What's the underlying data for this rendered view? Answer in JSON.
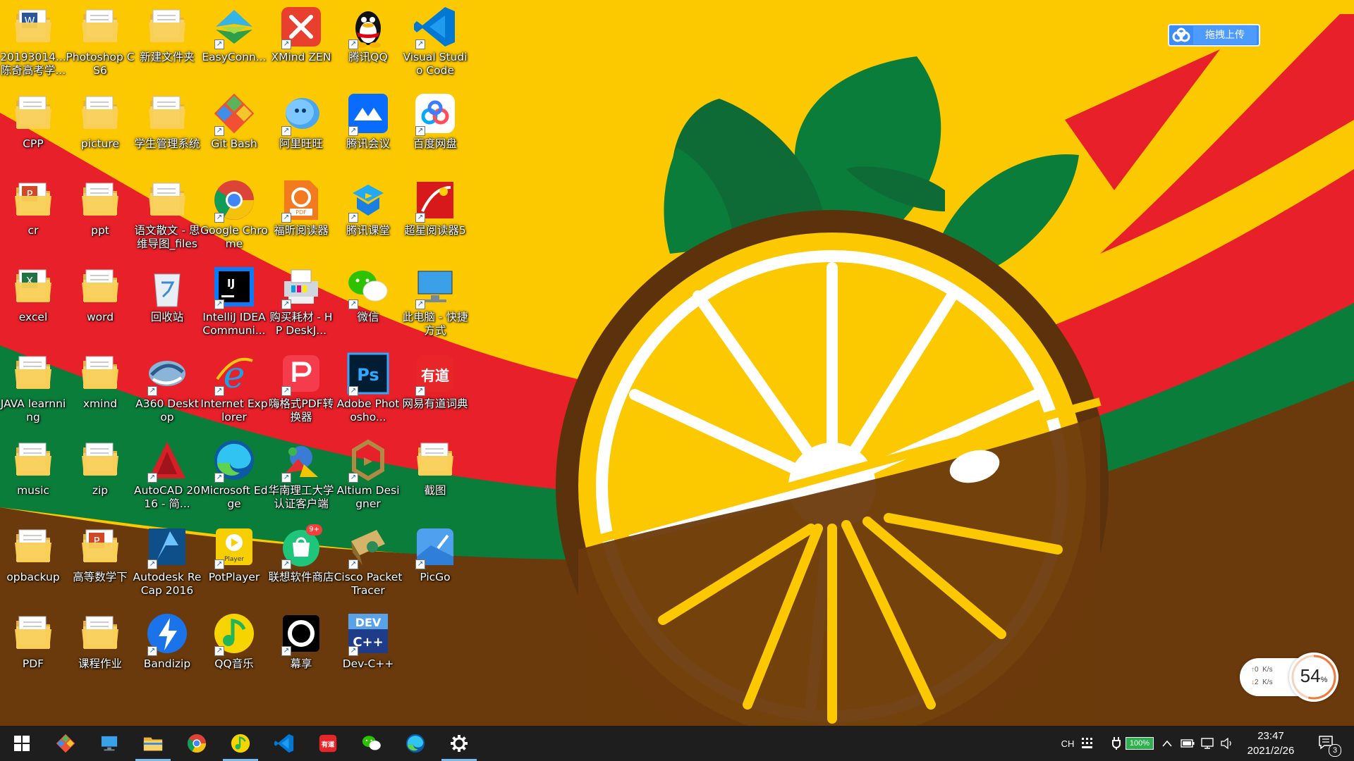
{
  "desktop": {
    "icons": [
      {
        "label": "20193014... 陈奇高考学...",
        "icon": "word-folder-icon",
        "shortcut": false
      },
      {
        "label": "Photoshop CS6",
        "icon": "folder-icon",
        "shortcut": false
      },
      {
        "label": "新建文件夹",
        "icon": "folder-icon",
        "shortcut": false
      },
      {
        "label": "EasyConn...",
        "icon": "easyconnect-icon",
        "shortcut": true
      },
      {
        "label": "XMind ZEN",
        "icon": "xmind-icon",
        "shortcut": true
      },
      {
        "label": "腾讯QQ",
        "icon": "qq-penguin-icon",
        "shortcut": true
      },
      {
        "label": "Visual Studio Code",
        "icon": "vscode-icon",
        "shortcut": true
      },
      {
        "label": "CPP",
        "icon": "folder-icon",
        "shortcut": false
      },
      {
        "label": "picture",
        "icon": "folder-icon",
        "shortcut": false
      },
      {
        "label": "学生管理系统",
        "icon": "folder-icon",
        "shortcut": false
      },
      {
        "label": "Git Bash",
        "icon": "git-bash-icon",
        "shortcut": true
      },
      {
        "label": "阿里旺旺",
        "icon": "aliwangwang-icon",
        "shortcut": true
      },
      {
        "label": "腾讯会议",
        "icon": "tencent-meeting-icon",
        "shortcut": true
      },
      {
        "label": "百度网盘",
        "icon": "baidu-netdisk-icon",
        "shortcut": true
      },
      {
        "label": "cr",
        "icon": "ppt-folder-icon",
        "shortcut": false
      },
      {
        "label": "ppt",
        "icon": "folder-icon",
        "shortcut": false
      },
      {
        "label": "语文散文 - 思维导图_files",
        "icon": "folder-icon",
        "shortcut": false
      },
      {
        "label": "Google Chrome",
        "icon": "chrome-icon",
        "shortcut": true
      },
      {
        "label": "福昕阅读器",
        "icon": "foxit-reader-icon",
        "shortcut": true
      },
      {
        "label": "腾讯课堂",
        "icon": "tencent-classroom-icon",
        "shortcut": true
      },
      {
        "label": "超星阅读器5",
        "icon": "chaoxing-reader-icon",
        "shortcut": true
      },
      {
        "label": "excel",
        "icon": "excel-folder-icon",
        "shortcut": false
      },
      {
        "label": "word",
        "icon": "folder-icon",
        "shortcut": false
      },
      {
        "label": "回收站",
        "icon": "recycle-bin-icon",
        "shortcut": false
      },
      {
        "label": "IntelliJ IDEA Communi...",
        "icon": "intellij-idea-icon",
        "shortcut": true
      },
      {
        "label": "购买耗材 - HP DeskJ...",
        "icon": "hp-printer-icon",
        "shortcut": true
      },
      {
        "label": "微信",
        "icon": "wechat-icon",
        "shortcut": true
      },
      {
        "label": "此电脑 - 快捷方式",
        "icon": "this-pc-icon",
        "shortcut": true
      },
      {
        "label": "JAVA learnning",
        "icon": "folder-icon",
        "shortcut": false
      },
      {
        "label": "xmind",
        "icon": "folder-icon",
        "shortcut": false
      },
      {
        "label": "A360 Desktop",
        "icon": "a360-icon",
        "shortcut": true
      },
      {
        "label": "Internet Explorer",
        "icon": "internet-explorer-icon",
        "shortcut": true
      },
      {
        "label": "嗨格式PDF转换器",
        "icon": "pdf-converter-icon",
        "shortcut": true
      },
      {
        "label": "Adobe Photosho...",
        "icon": "photoshop-icon",
        "shortcut": true
      },
      {
        "label": "网易有道词典",
        "icon": "youdao-dict-icon",
        "shortcut": true
      },
      {
        "label": "music",
        "icon": "folder-icon",
        "shortcut": false
      },
      {
        "label": "zip",
        "icon": "folder-icon",
        "shortcut": false
      },
      {
        "label": "AutoCAD 2016 - 简...",
        "icon": "autocad-icon",
        "shortcut": true
      },
      {
        "label": "Microsoft Edge",
        "icon": "edge-icon",
        "shortcut": true
      },
      {
        "label": "华南理工大学认证客户端",
        "icon": "scut-client-icon",
        "shortcut": true
      },
      {
        "label": "Altium Designer",
        "icon": "altium-designer-icon",
        "shortcut": true
      },
      {
        "label": "截图",
        "icon": "folder-icon",
        "shortcut": false
      },
      {
        "label": "opbackup",
        "icon": "folder-icon",
        "shortcut": false
      },
      {
        "label": "高等数学下",
        "icon": "ppt-folder-icon",
        "shortcut": false
      },
      {
        "label": "Autodesk ReCap 2016",
        "icon": "autodesk-recap-icon",
        "shortcut": true
      },
      {
        "label": "PotPlayer",
        "icon": "potplayer-icon",
        "shortcut": true
      },
      {
        "label": "联想软件商店",
        "icon": "lenovo-store-icon",
        "shortcut": true,
        "badge": "9+"
      },
      {
        "label": "Cisco Packet Tracer",
        "icon": "cisco-packet-tracer-icon",
        "shortcut": true
      },
      {
        "label": "PicGo",
        "icon": "picgo-icon",
        "shortcut": true
      },
      {
        "label": "PDF",
        "icon": "folder-icon",
        "shortcut": false
      },
      {
        "label": "课程作业",
        "icon": "folder-icon",
        "shortcut": false
      },
      {
        "label": "Bandizip",
        "icon": "bandizip-icon",
        "shortcut": true
      },
      {
        "label": "QQ音乐",
        "icon": "qq-music-icon",
        "shortcut": true
      },
      {
        "label": "幕享",
        "icon": "muxiang-icon",
        "shortcut": true
      },
      {
        "label": "Dev-C++",
        "icon": "dev-cpp-icon",
        "shortcut": true
      }
    ]
  },
  "baidu_float": {
    "label": "拖拽上传",
    "icon": "baidu-cloud-icon"
  },
  "net_widget": {
    "up_value": "0",
    "up_unit": "K/s",
    "down_value": "2",
    "down_unit": "K/s",
    "percent": "54",
    "percent_unit": "%"
  },
  "taskbar": {
    "buttons": [
      {
        "name": "start-button",
        "icon": "windows-logo-icon"
      },
      {
        "name": "taskbar-git",
        "icon": "git-icon"
      },
      {
        "name": "taskbar-this-pc",
        "icon": "this-pc-icon"
      },
      {
        "name": "taskbar-file-explorer",
        "icon": "folder-icon",
        "active": true
      },
      {
        "name": "taskbar-chrome",
        "icon": "chrome-icon"
      },
      {
        "name": "taskbar-qq-music",
        "icon": "qq-music-icon",
        "active": true
      },
      {
        "name": "taskbar-vscode",
        "icon": "vscode-icon"
      },
      {
        "name": "taskbar-youdao",
        "icon": "youdao-dict-icon"
      },
      {
        "name": "taskbar-wechat",
        "icon": "wechat-icon"
      },
      {
        "name": "taskbar-edge",
        "icon": "edge-icon"
      },
      {
        "name": "taskbar-settings",
        "icon": "gear-icon",
        "active": true
      }
    ],
    "tray": {
      "ime_label": "CH",
      "battery_percent": "100%",
      "time": "23:47",
      "date": "2021/2/26",
      "notification_count": "3"
    }
  },
  "colors": {
    "wallpaper_yellow": "#fcc800",
    "wallpaper_red": "#e8202a",
    "wallpaper_green": "#0a7d3a",
    "wallpaper_brown": "#6b3a0c",
    "taskbar_bg": "#1e1e1e",
    "accent": "#76b9ed"
  }
}
